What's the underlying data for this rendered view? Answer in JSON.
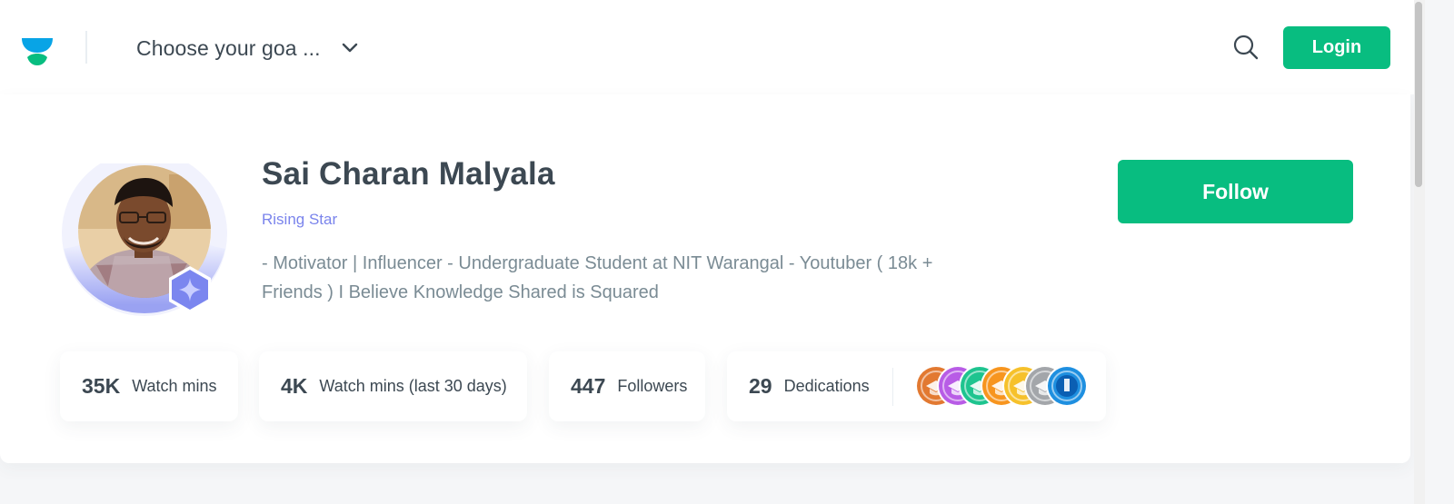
{
  "header": {
    "goal_selector": "Choose your goa ...",
    "login_label": "Login"
  },
  "profile": {
    "name": "Sai Charan Malyala",
    "rank": "Rising Star",
    "bio": "- Motivator | Influencer - Undergraduate Student at NIT Warangal - Youtuber ( 18k + Friends ) I Believe Knowledge Shared is Squared",
    "follow_label": "Follow"
  },
  "stats": [
    {
      "value": "35K",
      "label": "Watch mins"
    },
    {
      "value": "4K",
      "label": "Watch mins (last 30 days)"
    },
    {
      "value": "447",
      "label": "Followers"
    },
    {
      "value": "29",
      "label": "Dedications"
    }
  ],
  "dedication_badges": [
    {
      "color": "#e27931",
      "icon": "graduation-cap-icon"
    },
    {
      "color": "#b85ce6",
      "icon": "graduation-cap-icon"
    },
    {
      "color": "#1ec48f",
      "icon": "graduation-cap-icon"
    },
    {
      "color": "#f7951f",
      "icon": "graduation-cap-icon"
    },
    {
      "color": "#f6c12b",
      "icon": "graduation-cap-icon"
    },
    {
      "color": "#a3a6aa",
      "icon": "graduation-cap-icon"
    },
    {
      "color": "#1e8fe0",
      "icon": "event-2021-icon"
    }
  ],
  "colors": {
    "brand_green": "#08bd80",
    "rank_purple": "#7a84ec",
    "text_dark": "#3c4852",
    "text_muted": "#7a8b94"
  }
}
